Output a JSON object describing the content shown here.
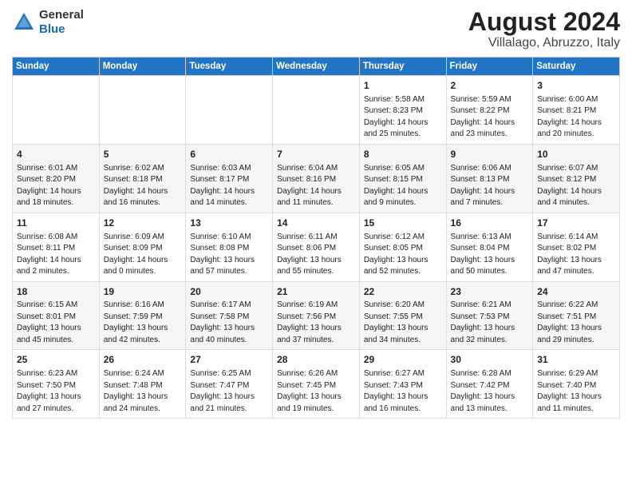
{
  "logo": {
    "general": "General",
    "blue": "Blue"
  },
  "header": {
    "month": "August 2024",
    "location": "Villalago, Abruzzo, Italy"
  },
  "weekdays": [
    "Sunday",
    "Monday",
    "Tuesday",
    "Wednesday",
    "Thursday",
    "Friday",
    "Saturday"
  ],
  "weeks": [
    [
      {
        "num": "",
        "info": ""
      },
      {
        "num": "",
        "info": ""
      },
      {
        "num": "",
        "info": ""
      },
      {
        "num": "",
        "info": ""
      },
      {
        "num": "1",
        "info": "Sunrise: 5:58 AM\nSunset: 8:23 PM\nDaylight: 14 hours\nand 25 minutes."
      },
      {
        "num": "2",
        "info": "Sunrise: 5:59 AM\nSunset: 8:22 PM\nDaylight: 14 hours\nand 23 minutes."
      },
      {
        "num": "3",
        "info": "Sunrise: 6:00 AM\nSunset: 8:21 PM\nDaylight: 14 hours\nand 20 minutes."
      }
    ],
    [
      {
        "num": "4",
        "info": "Sunrise: 6:01 AM\nSunset: 8:20 PM\nDaylight: 14 hours\nand 18 minutes."
      },
      {
        "num": "5",
        "info": "Sunrise: 6:02 AM\nSunset: 8:18 PM\nDaylight: 14 hours\nand 16 minutes."
      },
      {
        "num": "6",
        "info": "Sunrise: 6:03 AM\nSunset: 8:17 PM\nDaylight: 14 hours\nand 14 minutes."
      },
      {
        "num": "7",
        "info": "Sunrise: 6:04 AM\nSunset: 8:16 PM\nDaylight: 14 hours\nand 11 minutes."
      },
      {
        "num": "8",
        "info": "Sunrise: 6:05 AM\nSunset: 8:15 PM\nDaylight: 14 hours\nand 9 minutes."
      },
      {
        "num": "9",
        "info": "Sunrise: 6:06 AM\nSunset: 8:13 PM\nDaylight: 14 hours\nand 7 minutes."
      },
      {
        "num": "10",
        "info": "Sunrise: 6:07 AM\nSunset: 8:12 PM\nDaylight: 14 hours\nand 4 minutes."
      }
    ],
    [
      {
        "num": "11",
        "info": "Sunrise: 6:08 AM\nSunset: 8:11 PM\nDaylight: 14 hours\nand 2 minutes."
      },
      {
        "num": "12",
        "info": "Sunrise: 6:09 AM\nSunset: 8:09 PM\nDaylight: 14 hours\nand 0 minutes."
      },
      {
        "num": "13",
        "info": "Sunrise: 6:10 AM\nSunset: 8:08 PM\nDaylight: 13 hours\nand 57 minutes."
      },
      {
        "num": "14",
        "info": "Sunrise: 6:11 AM\nSunset: 8:06 PM\nDaylight: 13 hours\nand 55 minutes."
      },
      {
        "num": "15",
        "info": "Sunrise: 6:12 AM\nSunset: 8:05 PM\nDaylight: 13 hours\nand 52 minutes."
      },
      {
        "num": "16",
        "info": "Sunrise: 6:13 AM\nSunset: 8:04 PM\nDaylight: 13 hours\nand 50 minutes."
      },
      {
        "num": "17",
        "info": "Sunrise: 6:14 AM\nSunset: 8:02 PM\nDaylight: 13 hours\nand 47 minutes."
      }
    ],
    [
      {
        "num": "18",
        "info": "Sunrise: 6:15 AM\nSunset: 8:01 PM\nDaylight: 13 hours\nand 45 minutes."
      },
      {
        "num": "19",
        "info": "Sunrise: 6:16 AM\nSunset: 7:59 PM\nDaylight: 13 hours\nand 42 minutes."
      },
      {
        "num": "20",
        "info": "Sunrise: 6:17 AM\nSunset: 7:58 PM\nDaylight: 13 hours\nand 40 minutes."
      },
      {
        "num": "21",
        "info": "Sunrise: 6:19 AM\nSunset: 7:56 PM\nDaylight: 13 hours\nand 37 minutes."
      },
      {
        "num": "22",
        "info": "Sunrise: 6:20 AM\nSunset: 7:55 PM\nDaylight: 13 hours\nand 34 minutes."
      },
      {
        "num": "23",
        "info": "Sunrise: 6:21 AM\nSunset: 7:53 PM\nDaylight: 13 hours\nand 32 minutes."
      },
      {
        "num": "24",
        "info": "Sunrise: 6:22 AM\nSunset: 7:51 PM\nDaylight: 13 hours\nand 29 minutes."
      }
    ],
    [
      {
        "num": "25",
        "info": "Sunrise: 6:23 AM\nSunset: 7:50 PM\nDaylight: 13 hours\nand 27 minutes."
      },
      {
        "num": "26",
        "info": "Sunrise: 6:24 AM\nSunset: 7:48 PM\nDaylight: 13 hours\nand 24 minutes."
      },
      {
        "num": "27",
        "info": "Sunrise: 6:25 AM\nSunset: 7:47 PM\nDaylight: 13 hours\nand 21 minutes."
      },
      {
        "num": "28",
        "info": "Sunrise: 6:26 AM\nSunset: 7:45 PM\nDaylight: 13 hours\nand 19 minutes."
      },
      {
        "num": "29",
        "info": "Sunrise: 6:27 AM\nSunset: 7:43 PM\nDaylight: 13 hours\nand 16 minutes."
      },
      {
        "num": "30",
        "info": "Sunrise: 6:28 AM\nSunset: 7:42 PM\nDaylight: 13 hours\nand 13 minutes."
      },
      {
        "num": "31",
        "info": "Sunrise: 6:29 AM\nSunset: 7:40 PM\nDaylight: 13 hours\nand 11 minutes."
      }
    ]
  ]
}
